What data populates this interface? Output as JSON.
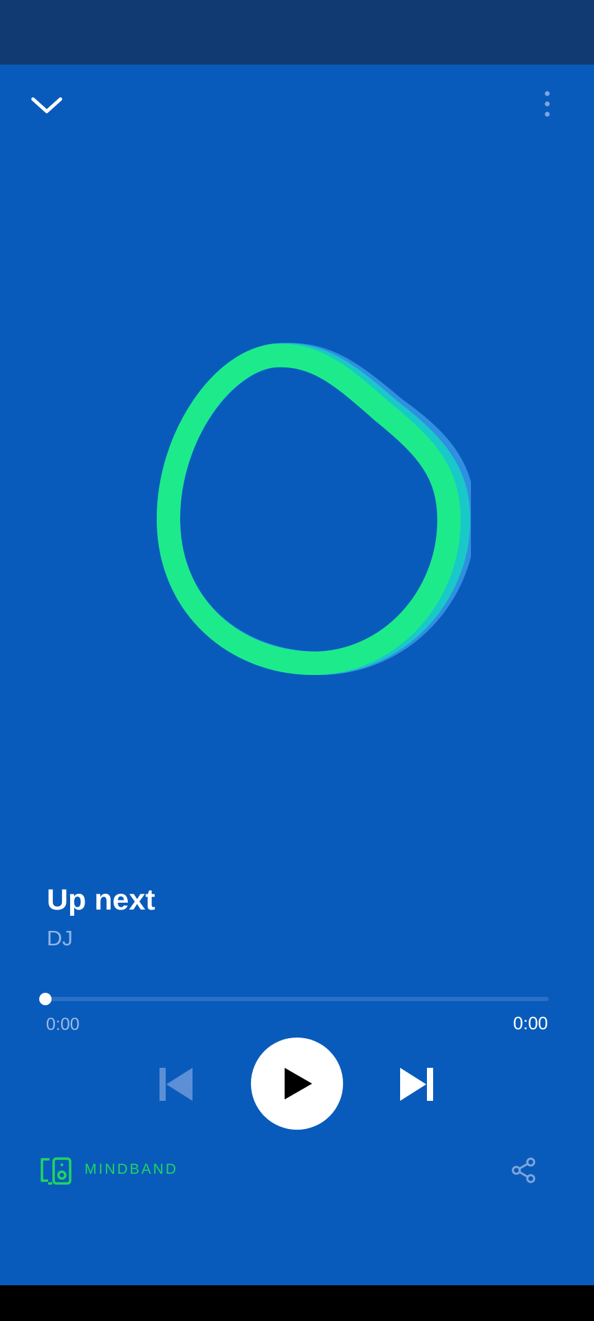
{
  "track": {
    "title": "Up next",
    "artist": "DJ"
  },
  "playback": {
    "elapsed": "0:00",
    "total": "0:00",
    "progress_fraction": 0.0,
    "state": "paused"
  },
  "device": {
    "label": "MINDBAND"
  },
  "icons": {
    "collapse": "chevron-down-icon",
    "more": "more-vertical-icon",
    "previous": "skip-previous-icon",
    "play": "play-icon",
    "next": "skip-next-icon",
    "device": "connect-device-icon",
    "share": "share-icon",
    "visual": "dj-ring-visual"
  },
  "colors": {
    "background": "#095bbb",
    "status_bar": "#123a72",
    "accent": "#1ed760",
    "ring": "#1deb8b",
    "ring_shadow_teal": "#18c9c8",
    "ring_shadow_blue": "#2f8fe0",
    "text_primary": "#ffffff",
    "text_secondary": "#93b7e4"
  }
}
